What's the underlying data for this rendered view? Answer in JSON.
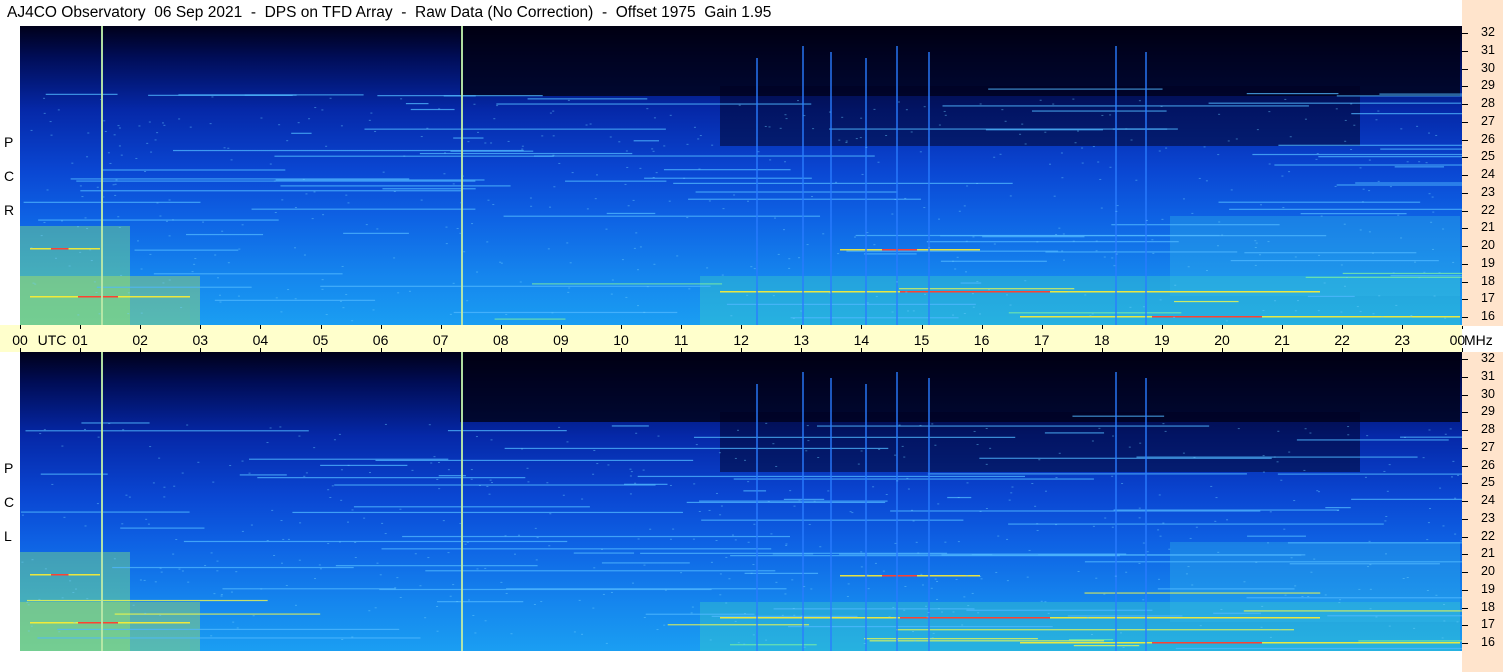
{
  "title": "AJ4CO Observatory  06 Sep 2021  -  DPS on TFD Array  -  Raw Data (No Correction)  -  Offset 1975  Gain 1.95",
  "panels": {
    "top": {
      "polarization": [
        "R",
        "C",
        "P"
      ]
    },
    "bottom": {
      "polarization": [
        "L",
        "C",
        "P"
      ]
    }
  },
  "time_axis": {
    "labels": [
      "00",
      "01",
      "02",
      "03",
      "04",
      "05",
      "06",
      "07",
      "08",
      "09",
      "10",
      "11",
      "12",
      "13",
      "14",
      "15",
      "16",
      "17",
      "18",
      "19",
      "20",
      "21",
      "22",
      "23",
      "00"
    ],
    "utc_label": "UTC",
    "unit_label": "MHz"
  },
  "freq_axis": {
    "labels": [
      "32",
      "31",
      "30",
      "29",
      "28",
      "27",
      "26",
      "25",
      "24",
      "23",
      "22",
      "21",
      "20",
      "19",
      "18",
      "17",
      "16"
    ]
  },
  "colors": {
    "background": "#ffffff",
    "time_strip": "#ffffcc",
    "freq_strip": "#ffe4cc",
    "spectrogram_low": "#00001a",
    "spectrogram_mid": "#0a46d2",
    "spectrogram_high": "#1a9ef2",
    "intense": "#ffff40",
    "peak": "#ff2020"
  }
}
